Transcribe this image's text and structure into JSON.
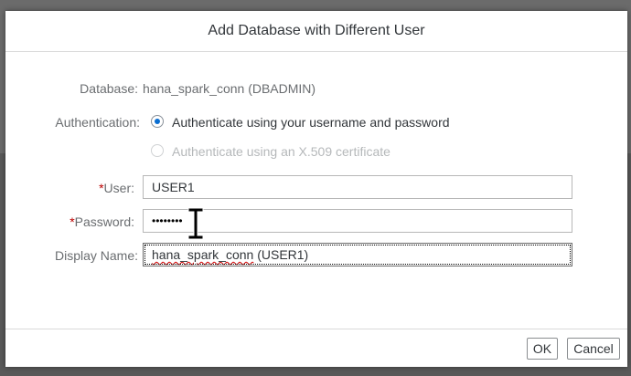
{
  "dialog": {
    "title": "Add Database with Different User"
  },
  "form": {
    "database_label": "Database:",
    "database_value": "hana_spark_conn (DBADMIN)",
    "authentication_label": "Authentication:",
    "auth_options": [
      {
        "label": "Authenticate using your username and password",
        "selected": true,
        "enabled": true
      },
      {
        "label": "Authenticate using an X.509 certificate",
        "selected": false,
        "enabled": false
      }
    ],
    "required_marker": "*",
    "user_label": "User:",
    "user_value": "USER1",
    "password_label": "Password:",
    "password_masked": "••••••••",
    "display_name_label": "Display Name:",
    "display_name_value_misspelled": "hana_spark_conn",
    "display_name_value_rest": " (USER1)"
  },
  "footer": {
    "ok_label": "OK",
    "cancel_label": "Cancel"
  },
  "colors": {
    "accent": "#0a6ed1",
    "required": "#bb0000"
  }
}
